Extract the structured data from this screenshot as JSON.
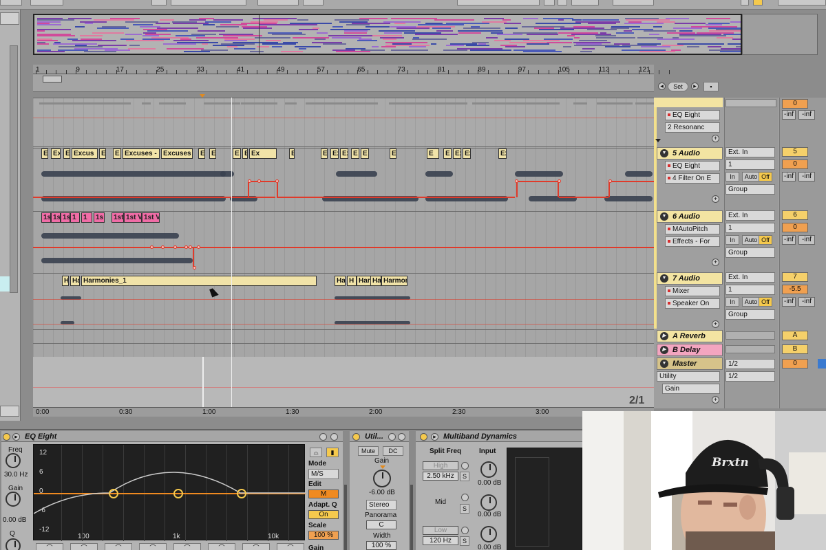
{
  "ruler": {
    "bars": [
      "1",
      "9",
      "17",
      "25",
      "33",
      "41",
      "49",
      "57",
      "65",
      "73",
      "81",
      "89",
      "97",
      "105",
      "113",
      "121"
    ]
  },
  "time_ruler": {
    "labels": [
      "0:00",
      "0:30",
      "1:00",
      "1:30",
      "2:00",
      "2:30",
      "3:00"
    ]
  },
  "zoom_label": "2/1",
  "locators": {
    "set_label": "Set"
  },
  "clips": {
    "track4": [
      "E",
      "Ex",
      "E",
      "Excus",
      "E",
      "E",
      "Excuses -",
      "Excuses",
      "E",
      "Excuse",
      "E",
      "E",
      "Ex",
      "E",
      "E",
      "Ex",
      "Ex",
      "E",
      "E",
      "Ex",
      "E",
      "E",
      "Ex",
      "Ex",
      "Exc"
    ],
    "track5": [
      "1s",
      "1s",
      "1s",
      "1",
      "1",
      "1s",
      "1st V",
      "1st V",
      "1st Versa"
    ],
    "track6": [
      "H",
      "Ha",
      "Harmonies_1",
      "Ha",
      "H",
      "Harn",
      "Ha",
      "Harmor"
    ]
  },
  "mixer": {
    "tracks": [
      {
        "name": "",
        "devices": [
          "EQ Eight",
          "2 Resonanc"
        ],
        "input": "",
        "number": "0",
        "vol": "-inf",
        "pan": "-inf"
      },
      {
        "name": "5 Audio",
        "devices": [
          "EQ Eight",
          "4 Filter On E"
        ],
        "input": "Ext. In",
        "channel": "1",
        "monitor": [
          "In",
          "Auto",
          "Off"
        ],
        "output": "Group",
        "number": "5",
        "vol": "0",
        "pan": "-inf",
        "pan2": "-inf"
      },
      {
        "name": "6 Audio",
        "devices": [
          "MAutoPitch",
          "Effects - For"
        ],
        "input": "Ext. In",
        "channel": "1",
        "monitor": [
          "In",
          "Auto",
          "Off"
        ],
        "output": "Group",
        "number": "6",
        "vol": "0",
        "pan": "-inf",
        "pan2": "-inf"
      },
      {
        "name": "7 Audio",
        "devices": [
          "Mixer",
          "Speaker On"
        ],
        "input": "Ext. In",
        "channel": "1",
        "monitor": [
          "In",
          "Auto",
          "Off"
        ],
        "output": "Group",
        "number": "7",
        "vol": "-5.5",
        "pan": "-inf",
        "pan2": "-inf"
      }
    ],
    "returns": [
      {
        "name": "A Reverb",
        "letter": "A"
      },
      {
        "name": "B Delay",
        "letter": "B"
      }
    ],
    "master": {
      "name": "Master",
      "devices": [
        "Utility",
        "Gain"
      ],
      "cue": "1/2",
      "out": "1/2",
      "number": "0"
    }
  },
  "devices": {
    "eq": {
      "title": "EQ Eight",
      "freq_label": "Freq",
      "freq_value": "30.0 Hz",
      "gain_label": "Gain",
      "gain_value": "0.00 dB",
      "q_label": "Q",
      "db_ticks": [
        "12",
        "6",
        "0",
        "-6",
        "-12"
      ],
      "freq_ticks": [
        "100",
        "1k",
        "10k"
      ],
      "mode_label": "Mode",
      "mode_value": "M/S",
      "edit_label": "Edit",
      "edit_value": "M",
      "adaptq_label": "Adapt. Q",
      "adaptq_value": "On",
      "scale_label": "Scale",
      "scale_value": "100 %",
      "gain2_label": "Gain"
    },
    "utility": {
      "title": "Util...",
      "mute": "Mute",
      "dc": "DC",
      "gain_label": "Gain",
      "gain_value": "-6.00 dB",
      "stereo": "Stereo",
      "panorama_label": "Panorama",
      "panorama_value": "C",
      "width_label": "Width",
      "width_value": "100 %"
    },
    "multiband": {
      "title": "Multiband Dynamics",
      "split_label": "Split Freq",
      "input_label": "Input",
      "high": "High",
      "high_freq": "2.50 kHz",
      "mid": "Mid",
      "low": "Low",
      "low_freq": "120 Hz",
      "in_high": "0.00 dB",
      "in_mid": "0.00 dB",
      "in_low": "0.00 dB",
      "s": "S"
    }
  },
  "webcam": {
    "cap_text": "Brxtn"
  }
}
